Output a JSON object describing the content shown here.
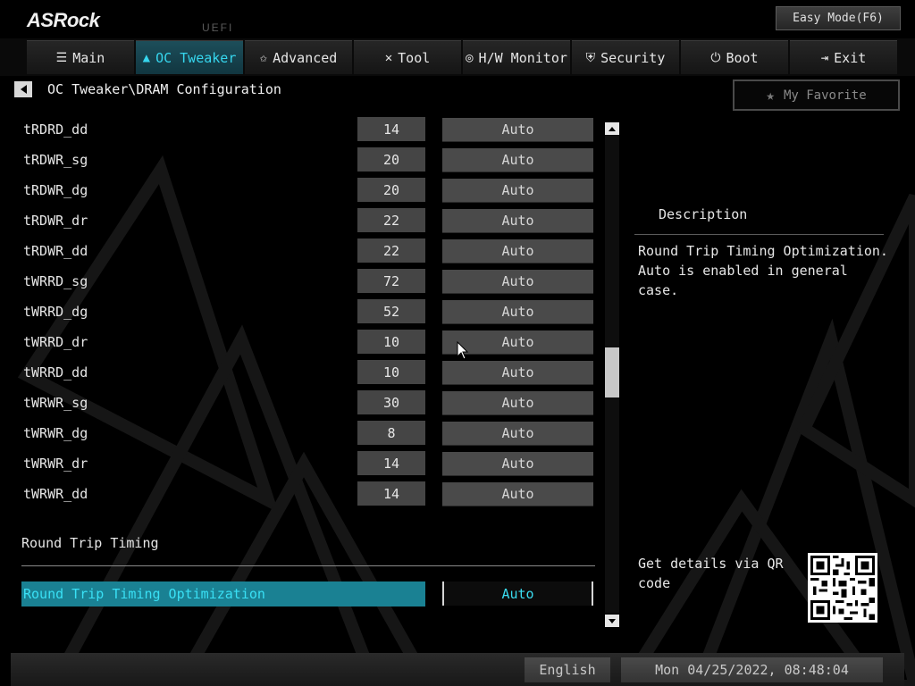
{
  "brand": {
    "logo_text": "ASRock",
    "uefi_label": "UEFI"
  },
  "header": {
    "easy_mode_label": "Easy Mode(F6)"
  },
  "tabs": [
    {
      "label": "Main",
      "icon": "list-icon"
    },
    {
      "label": "OC Tweaker",
      "icon": "rocket-icon",
      "active": true
    },
    {
      "label": "Advanced",
      "icon": "star-icon"
    },
    {
      "label": "Tool",
      "icon": "tools-icon"
    },
    {
      "label": "H/W Monitor",
      "icon": "monitor-icon"
    },
    {
      "label": "Security",
      "icon": "shield-icon"
    },
    {
      "label": "Boot",
      "icon": "power-icon"
    },
    {
      "label": "Exit",
      "icon": "exit-icon"
    }
  ],
  "breadcrumb": "OC Tweaker\\DRAM Configuration",
  "favorite_label": "My Favorite",
  "settings": [
    {
      "name": "tRDRD_dd",
      "value": "14",
      "option": "Auto"
    },
    {
      "name": "tRDWR_sg",
      "value": "20",
      "option": "Auto"
    },
    {
      "name": "tRDWR_dg",
      "value": "20",
      "option": "Auto"
    },
    {
      "name": "tRDWR_dr",
      "value": "22",
      "option": "Auto"
    },
    {
      "name": "tRDWR_dd",
      "value": "22",
      "option": "Auto"
    },
    {
      "name": "tWRRD_sg",
      "value": "72",
      "option": "Auto"
    },
    {
      "name": "tWRRD_dg",
      "value": "52",
      "option": "Auto"
    },
    {
      "name": "tWRRD_dr",
      "value": "10",
      "option": "Auto"
    },
    {
      "name": "tWRRD_dd",
      "value": "10",
      "option": "Auto"
    },
    {
      "name": "tWRWR_sg",
      "value": "30",
      "option": "Auto"
    },
    {
      "name": "tWRWR_dg",
      "value": "8",
      "option": "Auto"
    },
    {
      "name": "tWRWR_dr",
      "value": "14",
      "option": "Auto"
    },
    {
      "name": "tWRWR_dd",
      "value": "14",
      "option": "Auto"
    }
  ],
  "section": {
    "title": "Round Trip Timing",
    "selected_item": {
      "name": "Round Trip Timing Optimization",
      "option": "Auto"
    }
  },
  "description": {
    "title": "Description",
    "text": "Round Trip Timing Optimization. Auto is enabled in general case.",
    "qr_text": "Get details via QR code"
  },
  "footer": {
    "language": "English",
    "datetime": "Mon 04/25/2022, 08:48:04"
  },
  "colors": {
    "accent": "#36d6ee",
    "highlight_row": "#1a8193",
    "active_tab": "#1d4e5a"
  }
}
